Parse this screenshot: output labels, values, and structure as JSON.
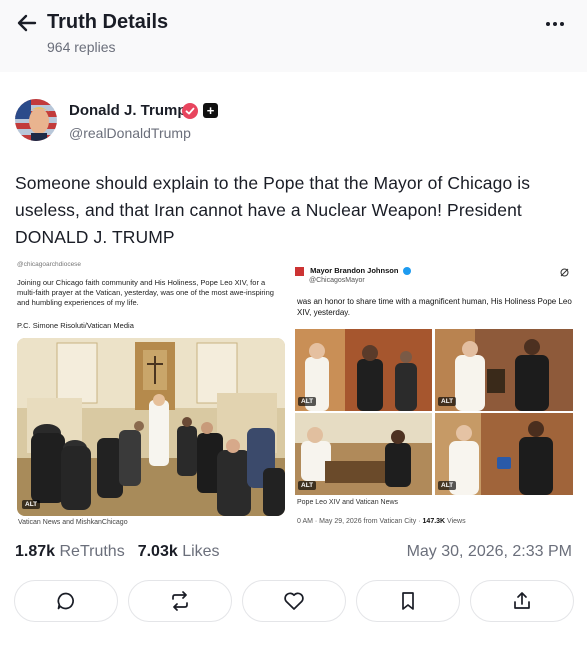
{
  "header": {
    "back_icon": "arrow-left-icon",
    "title": "Truth Details",
    "subtitle": "964 replies",
    "more_icon": "more-horizontal-icon"
  },
  "post": {
    "author_name": "Donald J. Trump",
    "author_handle": "@realDonaldTrump",
    "verified_icon": "verified-badge-icon",
    "plus_badge": "+",
    "text": "Someone should explain to the Pope that the Mayor of Chicago is useless, and that Iran cannot have a Nuclear Weapon! President DONALD J. TRUMP",
    "media_left": {
      "caption_top": "@chicagoarchdiocese",
      "caption": "Joining our Chicago faith community and His Holiness, Pope Leo XIV, for a multi-faith prayer at the Vatican, yesterday, was one of the most awe-inspiring and humbling experiences of my life.",
      "credit_line": "P.C. Simone Risoluti/Vatican Media",
      "alt_label": "ALT",
      "footer": "Vatican News and MishkanChicago"
    },
    "media_right": {
      "account_name": "Mayor Brandon Johnson",
      "account_handle": "@ChicagosMayor",
      "text": "was an honor to share time with a magnificent human, His Holiness Pope Leo XIV, yesterday.",
      "alt_label": "ALT",
      "footer_caption": "Pope Leo XIV and Vatican News",
      "footer_meta_prefix": "0 AM · May 29, 2026 from Vatican City · ",
      "footer_views": "147.3K",
      "footer_views_label": " Views"
    },
    "stats": {
      "retruths_count": "1.87k",
      "retruths_label": "ReTruths",
      "likes_count": "7.03k",
      "likes_label": "Likes",
      "date": "May 30, 2026, 2:33 PM"
    },
    "actions": [
      {
        "name": "reply",
        "icon": "comment-icon"
      },
      {
        "name": "retruth",
        "icon": "repost-icon"
      },
      {
        "name": "like",
        "icon": "heart-icon"
      },
      {
        "name": "bookmark",
        "icon": "bookmark-icon"
      },
      {
        "name": "share",
        "icon": "share-icon"
      }
    ]
  },
  "colors": {
    "accent_verified": "#e8455e",
    "text_primary": "#1a1d26",
    "text_secondary": "#6b6f7b",
    "border": "#e4e5e8"
  }
}
